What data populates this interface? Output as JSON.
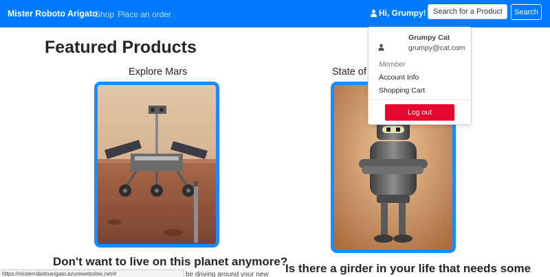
{
  "navbar": {
    "brand": "Mister Roboto Arigato",
    "links": [
      "Shop",
      "Place an order"
    ],
    "user_greeting": "Hi, Grumpy!",
    "search_placeholder": "Search for a Product",
    "search_label": "Search",
    "color": "#007bff",
    "user_icon": "user-icon",
    "caret_icon": "caret-down-icon"
  },
  "main": {
    "title": "Featured Products",
    "products": [
      {
        "name": "Explore Mars",
        "headline": "Don't want to live on this planet anymore?",
        "teaser": "be driving around your new",
        "image": "mars-rover-image"
      },
      {
        "name": "State of t",
        "headline": "Is there a girder in your life that needs some",
        "teaser": "",
        "image": "bender-robot-image"
      }
    ]
  },
  "status_bar": {
    "url": "https://misterrobotoarigato.azurewebsites.net/#"
  },
  "user_menu": {
    "name": "Grumpy Cat",
    "email": "grumpy@cat.com",
    "role": "Member",
    "items": [
      "Account Info",
      "Shopping Cart"
    ],
    "logout_label": "Log out",
    "logout_color": "#e8092e"
  }
}
